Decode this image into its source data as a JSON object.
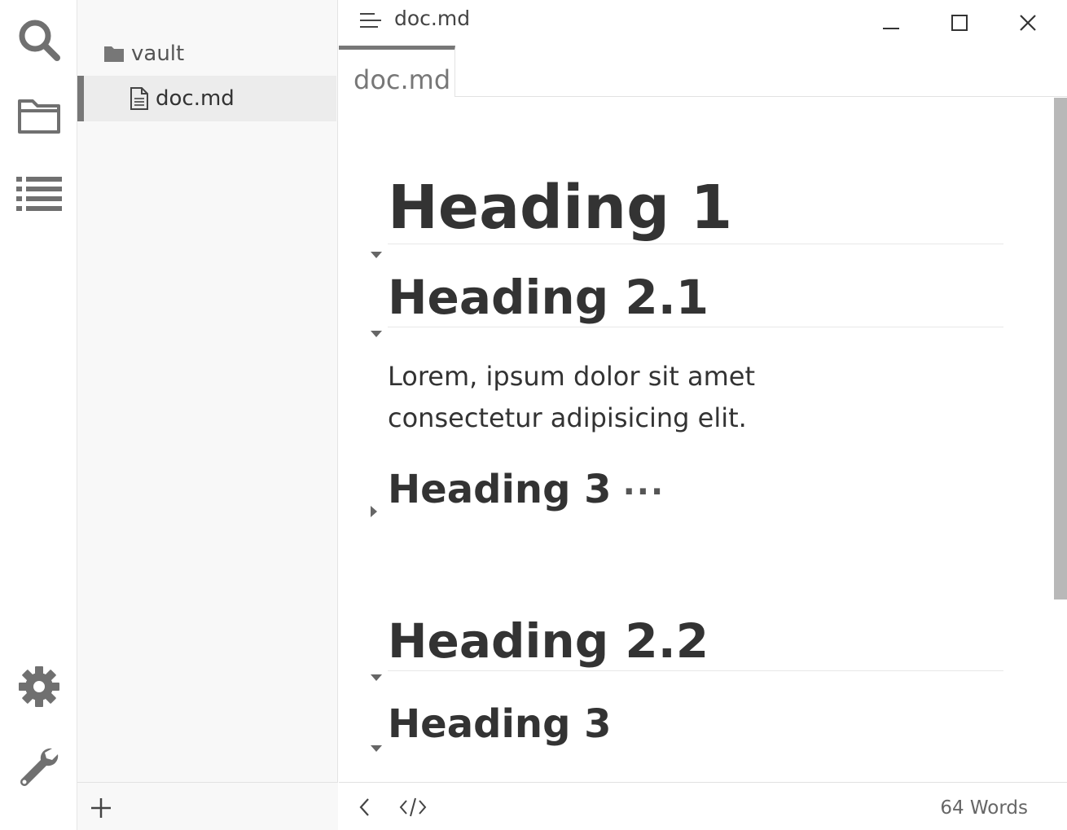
{
  "window": {
    "title": "doc.md"
  },
  "activity_bar": {
    "top_icons": [
      "search-icon",
      "folder-icon",
      "outline-list-icon"
    ],
    "bottom_icons": [
      "gear-icon",
      "wrench-icon"
    ]
  },
  "sidebar": {
    "folder": {
      "label": "vault",
      "icon": "folder-icon"
    },
    "file": {
      "label": "doc.md",
      "icon": "file-icon",
      "active": true
    }
  },
  "tabs": [
    {
      "label": "doc.md",
      "active": true
    }
  ],
  "document": {
    "headings": [
      {
        "level": 1,
        "text": "Heading 1",
        "collapsed": false
      },
      {
        "level": 2,
        "text": "Heading 2.1",
        "collapsed": false
      },
      {
        "level": 3,
        "text": "Heading 3",
        "collapsed": true,
        "ellipsis": "···"
      },
      {
        "level": 2,
        "text": "Heading 2.2",
        "collapsed": false
      },
      {
        "level": 3,
        "text": "Heading 3",
        "collapsed": false
      }
    ],
    "paragraph": "Lorem, ipsum dolor sit amet consectetur adipisicing elit."
  },
  "status_bar": {
    "word_count": "64 Words"
  },
  "colors": {
    "icon": "#707070",
    "active_accent": "#777777",
    "text": "#333333",
    "scrollbar": "#b8b8b8"
  }
}
